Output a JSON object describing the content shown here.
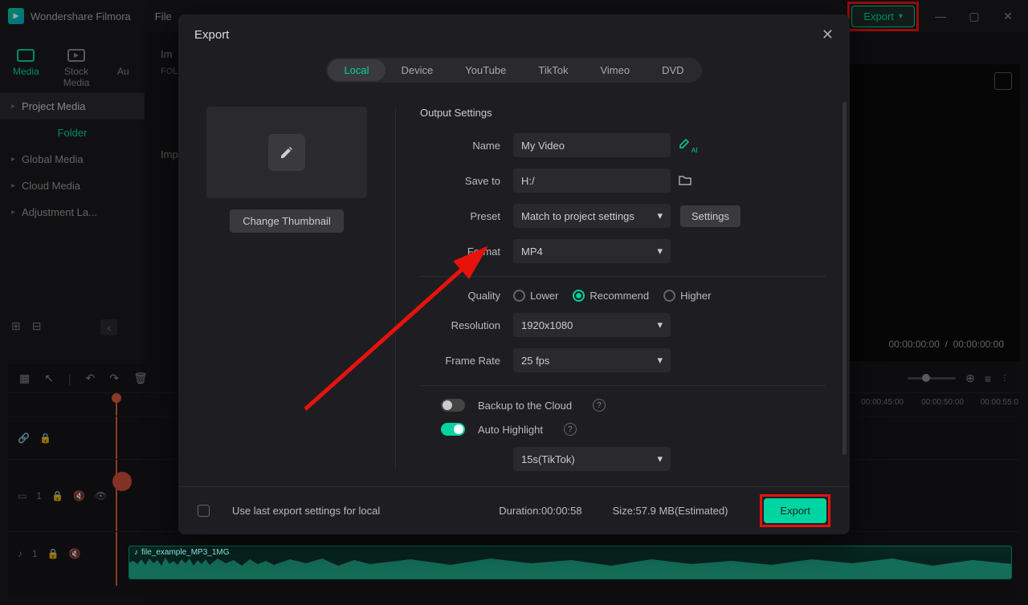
{
  "app": {
    "name": "Wondershare Filmora"
  },
  "menubar": {
    "file": "File"
  },
  "topExport": {
    "label": "Export"
  },
  "sidebar": {
    "tabs": {
      "media": "Media",
      "stock": "Stock Media",
      "au": "Au"
    },
    "items": {
      "project": "Project Media",
      "folder": "Folder",
      "global": "Global Media",
      "cloud": "Cloud Media",
      "adjustment": "Adjustment La..."
    }
  },
  "centerLabels": {
    "im": "Im",
    "folder": "FOLD",
    "import": "Imp"
  },
  "preview": {
    "time_left": "00:00:00:00",
    "time_right": "00:00:00:00"
  },
  "timeline": {
    "ticks": [
      "50:00",
      "00:00:45:00",
      "00:00:50:00",
      "00:00:55:0"
    ],
    "audioClip": "file_example_MP3_1MG"
  },
  "modal": {
    "title": "Export",
    "tabs": {
      "local": "Local",
      "device": "Device",
      "youtube": "YouTube",
      "tiktok": "TikTok",
      "vimeo": "Vimeo",
      "dvd": "DVD"
    },
    "changeThumb": "Change Thumbnail",
    "sectionTitle": "Output Settings",
    "labels": {
      "name": "Name",
      "saveTo": "Save to",
      "preset": "Preset",
      "format": "Format",
      "quality": "Quality",
      "resolution": "Resolution",
      "frameRate": "Frame Rate",
      "backup": "Backup to the Cloud",
      "autoHighlight": "Auto Highlight"
    },
    "values": {
      "name": "My Video",
      "saveTo": "H:/",
      "preset": "Match to project settings",
      "format": "MP4",
      "resolution": "1920x1080",
      "frameRate": "25 fps",
      "highlightPreset": "15s(TikTok)"
    },
    "quality": {
      "lower": "Lower",
      "recommend": "Recommend",
      "higher": "Higher"
    },
    "settingsBtn": "Settings",
    "footer": {
      "useLast": "Use last export settings for local",
      "duration": "Duration:00:00:58",
      "size": "Size:57.9 MB(Estimated)",
      "export": "Export"
    }
  }
}
